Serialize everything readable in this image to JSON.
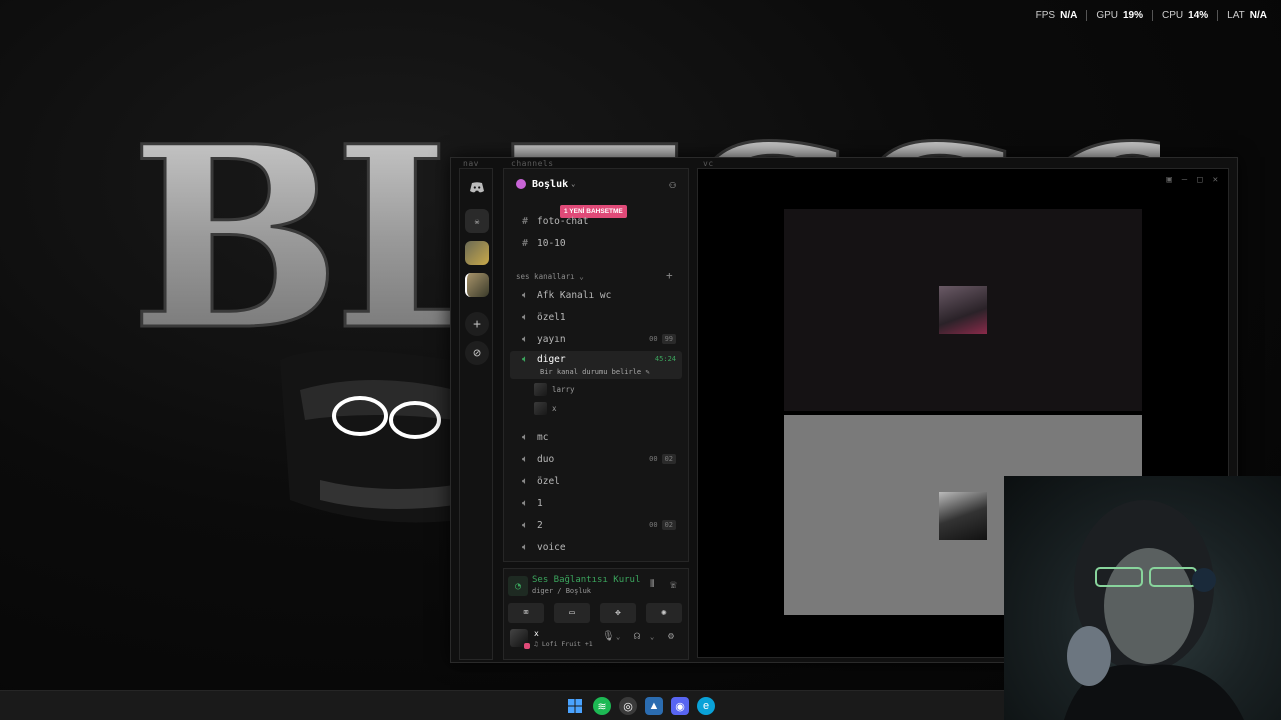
{
  "perf": {
    "fps_label": "FPS",
    "fps_value": "N/A",
    "gpu_label": "GPU",
    "gpu_value": "19%",
    "cpu_label": "CPU",
    "cpu_value": "14%",
    "lat_label": "LAT",
    "lat_value": "N/A"
  },
  "desktop": {
    "banner_text": "BLESSOSS"
  },
  "discord": {
    "nav_label": "nav",
    "channels_label": "channels",
    "vc_label": "vc",
    "user_label": "user",
    "server": {
      "name": "Boşluk",
      "new_messages_badge": "1 YENİ BAHSETME"
    },
    "text_channels": [
      "foto-chat",
      "10-10"
    ],
    "category": "ses kanalları",
    "voice_channels": [
      {
        "name": "Afk Kanalı wc",
        "count": ""
      },
      {
        "name": "özel1",
        "count": ""
      },
      {
        "name": "yayın",
        "count_users": "00",
        "count_limit": "99"
      },
      {
        "name": "diger",
        "timer": "45:24",
        "status": "Bir kanal durumu belirle ✎"
      },
      {
        "name": "mc",
        "count": ""
      },
      {
        "name": "duo",
        "count_users": "00",
        "count_limit": "02"
      },
      {
        "name": "özel",
        "count": ""
      },
      {
        "name": "1",
        "count": ""
      },
      {
        "name": "2",
        "count_users": "00",
        "count_limit": "02"
      },
      {
        "name": "voice",
        "count": ""
      }
    ],
    "members_in_diger": [
      "larry",
      "x"
    ],
    "voice_connection": {
      "title": "Ses Bağlantısı Kurul",
      "subtitle": "diger / Boşluk"
    },
    "current_user": {
      "name": "x",
      "activity": "♫ Lofi Fruit +1"
    }
  },
  "colors": {
    "accent_green": "#3ba55d",
    "badge_pink": "#e04a78",
    "server_icon": "#c864d6"
  },
  "taskbar": {
    "icons": [
      "windows-icon",
      "spotify-icon",
      "chrome-icon",
      "photos-icon",
      "discord-icon",
      "edge-icon"
    ]
  }
}
